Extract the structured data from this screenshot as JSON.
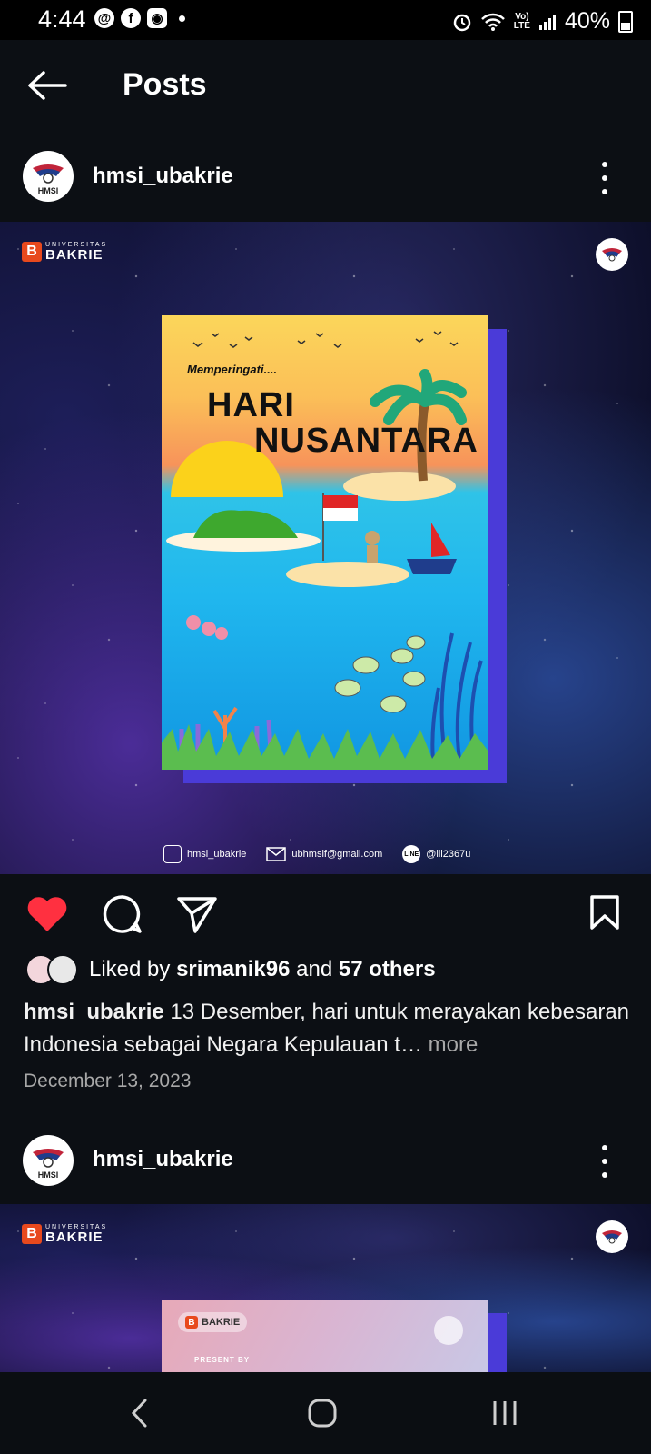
{
  "status_bar": {
    "time": "4:44",
    "battery": "40%",
    "notification_icons": [
      "threads-icon",
      "facebook-icon",
      "instagram-icon"
    ],
    "network": "VoLTE"
  },
  "header": {
    "title": "Posts"
  },
  "posts": [
    {
      "username": "hmsi_ubakrie",
      "avatar_text": "HMSI",
      "image": {
        "brand_small": "UNIVERSITAS",
        "brand_big": "BAKRIE",
        "poster": {
          "subtitle": "Memperingati....",
          "title_line1": "HARI",
          "title_line2": "NUSANTARA"
        },
        "contacts": {
          "instagram": "hmsi_ubakrie",
          "email": "ubhmsif@gmail.com",
          "line": "@lil2367u"
        }
      },
      "liked_by_prefix": "Liked by",
      "liked_by_user": "srimanik96",
      "liked_by_and": "and",
      "liked_by_others": "57 others",
      "caption_user": "hmsi_ubakrie",
      "caption_text": "13 Desember, hari untuk merayakan kebesaran Indonesia sebagai Negara Kepulauan t…",
      "caption_more": "more",
      "date": "December 13, 2023"
    },
    {
      "username": "hmsi_ubakrie",
      "avatar_text": "HMSI",
      "image": {
        "brand_small": "UNIVERSITAS",
        "brand_big": "BAKRIE",
        "poster_brand": "BAKRIE",
        "poster_text": "PRESENT BY"
      }
    }
  ]
}
